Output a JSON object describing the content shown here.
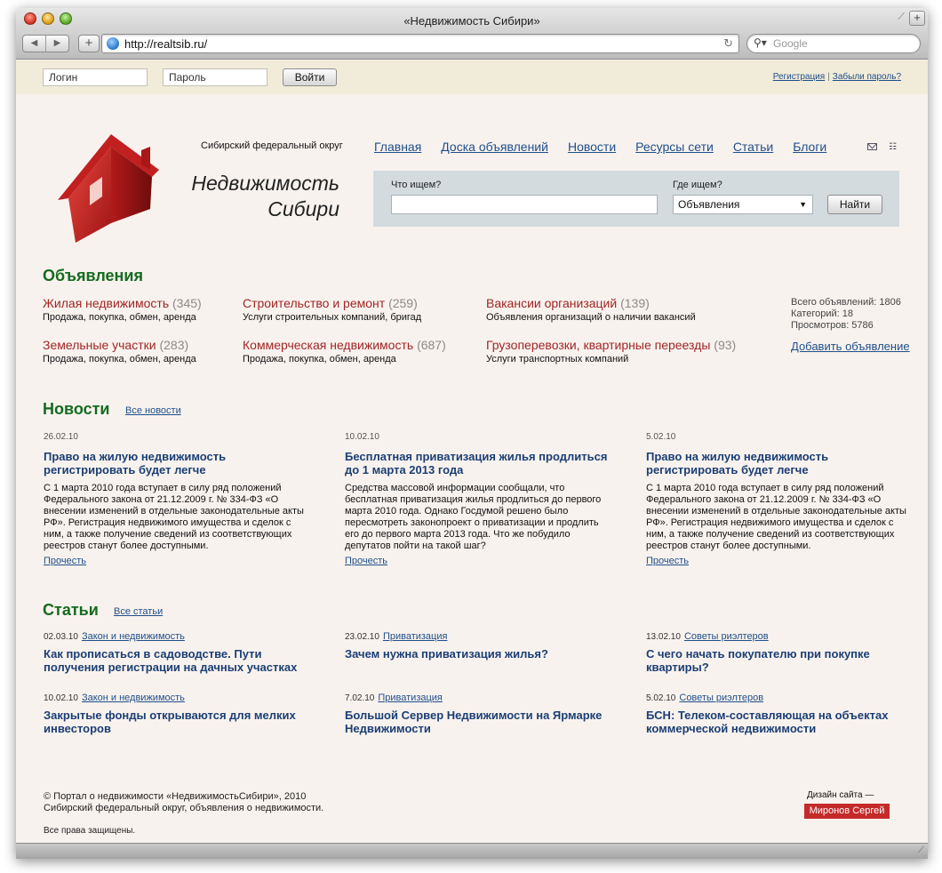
{
  "browser": {
    "window_title": "«Недвижимость Сибири»",
    "url": "http://realtsib.ru/",
    "search_placeholder": "Google",
    "new_tab_glyph": "+"
  },
  "login": {
    "login_placeholder": "Логин",
    "password_placeholder": "Пароль",
    "submit_label": "Войти",
    "register_link": "Регистрация",
    "separator": "|",
    "forgot_link": "Забыли пароль?"
  },
  "header": {
    "region": "Сибирский федеральный округ",
    "brand_line1": "Недвижимость",
    "brand_line2": "Сибири",
    "nav": [
      "Главная",
      "Доска объявлений",
      "Новости",
      "Ресурсы сети",
      "Статьи",
      "Блоги"
    ]
  },
  "search": {
    "what_label": "Что ищем?",
    "where_label": "Где ищем?",
    "where_value": "Объявления",
    "submit_label": "Найти"
  },
  "ads": {
    "title": "Объявления",
    "categories": [
      {
        "name": "Жилая недвижимость",
        "count": "(345)",
        "desc": "Продажа, покупка, обмен, аренда"
      },
      {
        "name": "Строительство и ремонт",
        "count": "(259)",
        "desc": "Услуги строительных компаний, бригад"
      },
      {
        "name": "Вакансии организаций",
        "count": "(139)",
        "desc": "Объявления организаций о наличии вакансий"
      },
      {
        "name": "Земельные участки",
        "count": "(283)",
        "desc": "Продажа, покупка, обмен, аренда"
      },
      {
        "name": "Коммерческая недвижимость",
        "count": "(687)",
        "desc": "Продажа, покупка, обмен, аренда"
      },
      {
        "name": "Грузоперевозки, квартирные переезды",
        "count": "(93)",
        "desc": "Услуги транспортных компаний"
      }
    ],
    "stats": {
      "total": "Всего объявлений: 1806",
      "categories": "Категорий: 18",
      "views": "Просмотров: 5786"
    },
    "add_link": "Добавить объявление"
  },
  "news": {
    "title": "Новости",
    "all_link": "Все новости",
    "read_label": "Прочесть",
    "items": [
      {
        "date": "26.02.10",
        "title": "Право на жилую недвижимость регистрировать будет легче",
        "body": "С 1 марта 2010 года вступает в силу ряд положений Федерального закона от 21.12.2009 г. № 334-ФЗ «О внесении изменений в отдельные законодательные акты РФ». Регистрация недвижимого имущества и сделок с ним, а также получение сведений из соответствующих реестров станут более доступными."
      },
      {
        "date": "10.02.10",
        "title": "Бесплатная приватизация жилья продлиться до 1 марта 2013 года",
        "body": "Средства массовой информации сообщали, что бесплатная приватизация жилья продлиться до первого марта 2010 года. Однако Госдумой решено было пересмотреть законопроект о приватизации и продлить его до первого марта 2013 года. Что же побудило депутатов пойти на такой шаг?"
      },
      {
        "date": "5.02.10",
        "title": "Право на жилую недвижимость регистрировать будет легче",
        "body": "С 1 марта 2010 года вступает в силу ряд положений Федерального закона от 21.12.2009 г. № 334-ФЗ «О внесении изменений в отдельные законодательные акты РФ». Регистрация недвижимого имущества и сделок с ним, а также получение сведений из соответствующих реестров станут более доступными."
      }
    ]
  },
  "articles": {
    "title": "Статьи",
    "all_link": "Все статьи",
    "items": [
      {
        "date": "02.03.10",
        "category": "Закон и недвижимость",
        "title": "Как прописаться в садоводстве. Пути получения регистрации на дачных участках"
      },
      {
        "date": "23.02.10",
        "category": "Приватизация",
        "title": "Зачем нужна приватизация жилья?"
      },
      {
        "date": "13.02.10",
        "category": "Советы риэлтеров",
        "title": "С чего начать покупателю при покупке квартиры?"
      },
      {
        "date": "10.02.10",
        "category": "Закон и недвижимость",
        "title": "Закрытые фонды открываются для мелких инвесторов"
      },
      {
        "date": "7.02.10",
        "category": "Приватизация",
        "title": "Большой Сервер Недвижимости на Ярмарке Недвижимости"
      },
      {
        "date": "5.02.10",
        "category": "Советы риэлтеров",
        "title": "БСН: Телеком-составляющая на объектах коммерческой недвижимости"
      }
    ]
  },
  "footer": {
    "copyright_line1": "© Портал о недвижимости «НедвижимостьСибири», 2010",
    "copyright_line2": "Сибирский федеральный округ, объявления о недвижимости.",
    "rights": "Все права защищены.",
    "design_label": "Дизайн сайта —",
    "designer": "Миронов Сергей"
  },
  "colors": {
    "section_title": "#146b1e",
    "ad_link": "#a02626",
    "news_title": "#1b3f74",
    "link": "#1f4f8a",
    "page_bg": "#f8f2ee",
    "login_bar_bg": "#f1ebd9",
    "search_box_bg": "#d3dbdf",
    "designer_badge": "#c42a2a"
  }
}
